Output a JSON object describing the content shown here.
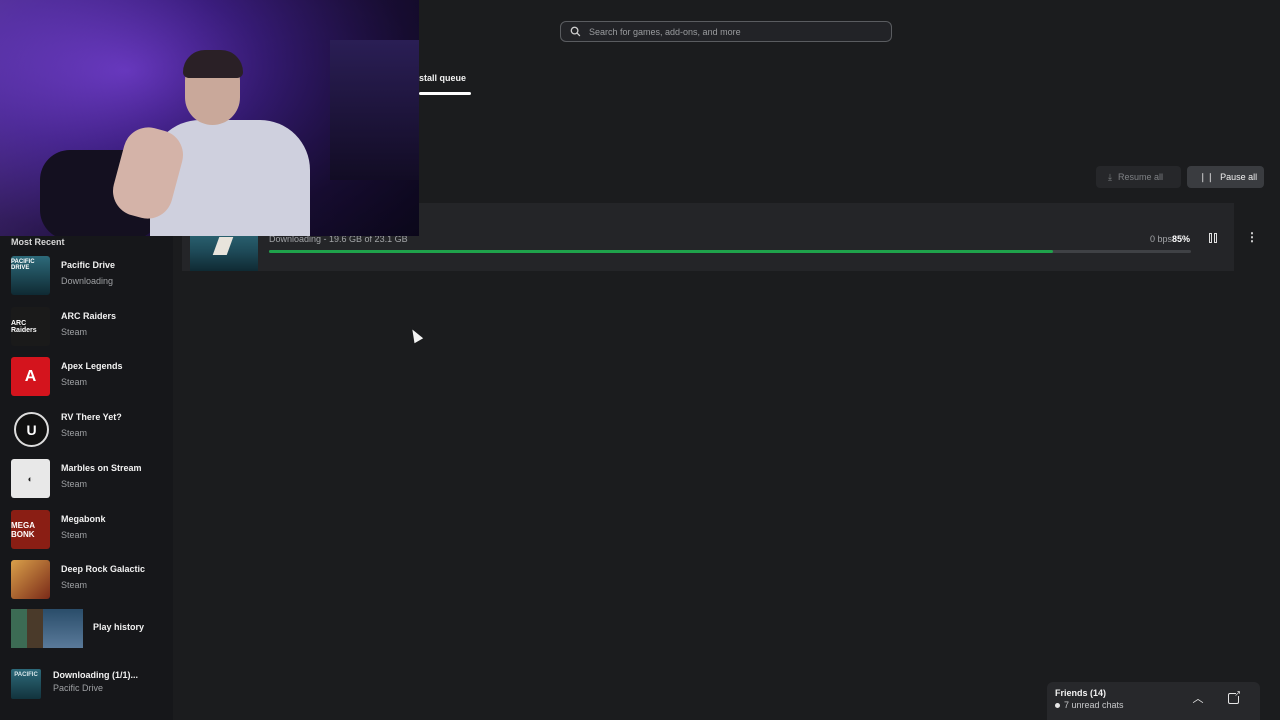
{
  "search": {
    "placeholder": "Search for games, add-ons, and more",
    "icon": "search-icon"
  },
  "tabs": {
    "active_label": "stall queue"
  },
  "queue_actions": {
    "resume_all": "Resume all",
    "pause_all": "Pause all"
  },
  "download": {
    "game": "Pacific Drive",
    "status": "Downloading - 19.6 GB of 23.1 GB",
    "speed": "0 bps",
    "percent_label": "85%",
    "progress": 0.85,
    "progress_color": "#1fa24b"
  },
  "sidebar": {
    "section_title": "Most Recent",
    "games": [
      {
        "name": "Pacific Drive",
        "sub": "Downloading",
        "icon": "pacific-drive-art",
        "color": "#2d6a7a",
        "label": "PACIFIC DRIVE"
      },
      {
        "name": "ARC Raiders",
        "sub": "Steam",
        "icon": "arc-raiders-art",
        "color": "#1a1a1a",
        "label": "ARC Raiders"
      },
      {
        "name": "Apex Legends",
        "sub": "Steam",
        "icon": "apex-legends-logo",
        "color": "#d4141d",
        "label": "A"
      },
      {
        "name": "RV There Yet?",
        "sub": "Steam",
        "icon": "unreal-logo",
        "color": "#111111",
        "label": "U"
      },
      {
        "name": "Marbles on Stream",
        "sub": "Steam",
        "icon": "marbles-logo",
        "color": "#e8e8e8",
        "label": "◐"
      },
      {
        "name": "Megabonk",
        "sub": "Steam",
        "icon": "megabonk-art",
        "color": "#8a1e14",
        "label": "MEGA BONK"
      },
      {
        "name": "Deep Rock Galactic",
        "sub": "Steam",
        "icon": "deep-rock-art",
        "color": "#b5552a",
        "label": ""
      }
    ],
    "play_history": "Play history",
    "downloading": {
      "title": "Downloading (1/1)...",
      "game": "Pacific Drive",
      "thumb_label": "PACIFIC"
    }
  },
  "friends": {
    "title": "Friends (14)",
    "unread": "7 unread chats"
  }
}
